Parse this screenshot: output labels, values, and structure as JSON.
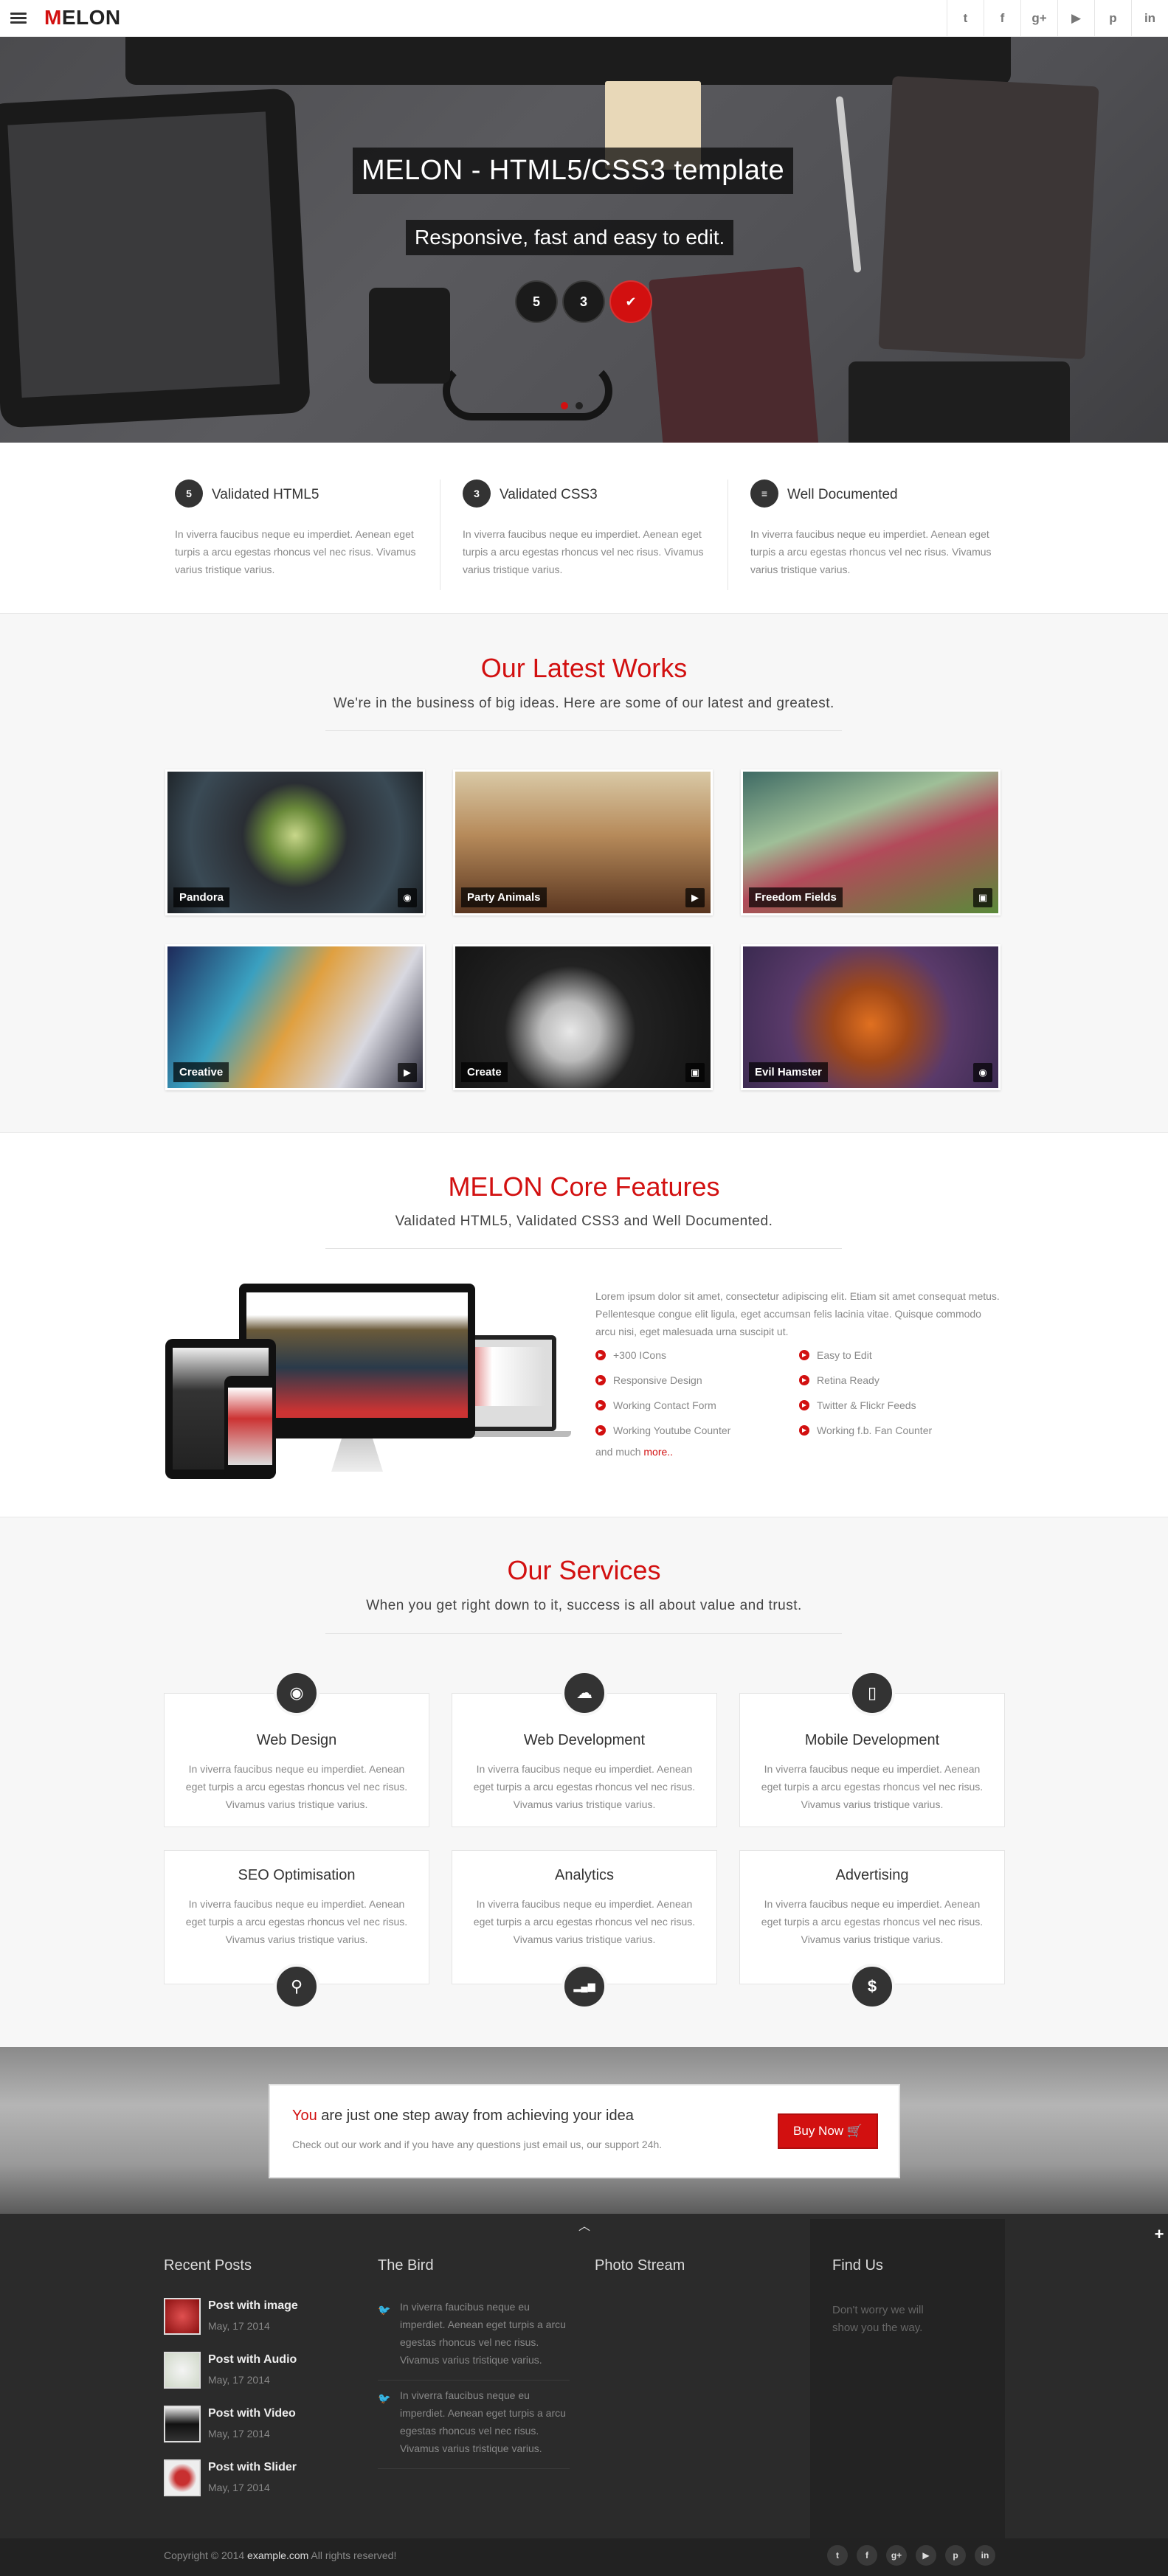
{
  "header": {
    "logo_first": "M",
    "logo_rest": "ELON",
    "social": [
      "twitter-icon",
      "facebook-icon",
      "google-plus-icon",
      "youtube-icon",
      "pinterest-icon",
      "linkedin-icon"
    ],
    "social_glyphs": [
      "t",
      "f",
      "g+",
      "▶",
      "p",
      "in"
    ]
  },
  "hero": {
    "title": "MELON - HTML5/CSS3 template",
    "subtitle": "Responsive, fast and easy to edit.",
    "badges": [
      "5",
      "3",
      "✔"
    ]
  },
  "features": [
    {
      "title": "Validated HTML5",
      "text": "In viverra faucibus neque eu imperdiet. Aenean eget turpis a arcu egestas rhoncus vel nec risus. Vivamus varius tristique varius.",
      "icon": "html5-icon",
      "glyph": "5"
    },
    {
      "title": "Validated CSS3",
      "text": "In viverra faucibus neque eu imperdiet. Aenean eget turpis a arcu egestas rhoncus vel nec risus. Vivamus varius tristique varius.",
      "icon": "css3-icon",
      "glyph": "3"
    },
    {
      "title": "Well Documented",
      "text": "In viverra faucibus neque eu imperdiet. Aenean eget turpis a arcu egestas rhoncus vel nec risus. Vivamus varius tristique varius.",
      "icon": "book-icon",
      "glyph": "≡"
    }
  ],
  "works": {
    "title": "Our Latest Works",
    "subtitle": "We're in the business of big ideas. Here are some of our latest and greatest.",
    "items": [
      {
        "caption": "Pandora",
        "icon": "globe-icon",
        "glyph": "◉"
      },
      {
        "caption": "Party Animals",
        "icon": "play-icon",
        "glyph": "▶"
      },
      {
        "caption": "Freedom Fields",
        "icon": "image-icon",
        "glyph": "▣"
      },
      {
        "caption": "Creative",
        "icon": "play-icon",
        "glyph": "▶"
      },
      {
        "caption": "Create",
        "icon": "image-icon",
        "glyph": "▣"
      },
      {
        "caption": "Evil Hamster",
        "icon": "globe-icon",
        "glyph": "◉"
      }
    ]
  },
  "core": {
    "title": "MELON Core Features",
    "subtitle": "Validated HTML5, Validated CSS3 and Well Documented.",
    "text": "Lorem ipsum dolor sit amet, consectetur adipiscing elit. Etiam sit amet consequat metus. Pellentesque congue elit ligula, eget accumsan felis lacinia vitae. Quisque commodo arcu nisi, eget malesuada urna suscipit ut.",
    "list_left": [
      "+300 ICons",
      "Responsive Design",
      "Working Contact Form",
      "Working Youtube Counter"
    ],
    "list_right": [
      "Easy to Edit",
      "Retina Ready",
      "Twitter & Flickr Feeds",
      "Working f.b. Fan Counter"
    ],
    "more_prefix": "and much ",
    "more_link": "more.."
  },
  "services": {
    "title": "Our Services",
    "subtitle": "When you get right down to it, success is all about value and trust.",
    "items": [
      {
        "title": "Web Design",
        "text": "In viverra faucibus neque eu imperdiet. Aenean eget turpis a arcu egestas rhoncus vel nec risus. Vivamus varius tristique varius.",
        "icon": "globe-icon",
        "glyph": "◉"
      },
      {
        "title": "Web Development",
        "text": "In viverra faucibus neque eu imperdiet. Aenean eget turpis a arcu egestas rhoncus vel nec risus. Vivamus varius tristique varius.",
        "icon": "cloud-icon",
        "glyph": "☁"
      },
      {
        "title": "Mobile Development",
        "text": "In viverra faucibus neque eu imperdiet. Aenean eget turpis a arcu egestas rhoncus vel nec risus. Vivamus varius tristique varius.",
        "icon": "mobile-icon",
        "glyph": "▯"
      },
      {
        "title": "SEO Optimisation",
        "text": "In viverra faucibus neque eu imperdiet. Aenean eget turpis a arcu egestas rhoncus vel nec risus. Vivamus varius tristique varius.",
        "icon": "search-icon",
        "glyph": "⚲"
      },
      {
        "title": "Analytics",
        "text": "In viverra faucibus neque eu imperdiet. Aenean eget turpis a arcu egestas rhoncus vel nec risus. Vivamus varius tristique varius.",
        "icon": "signal-icon",
        "glyph": "▂▄▆"
      },
      {
        "title": "Advertising",
        "text": "In viverra faucibus neque eu imperdiet. Aenean eget turpis a arcu egestas rhoncus vel nec risus. Vivamus varius tristique varius.",
        "icon": "dollar-icon",
        "glyph": "$"
      }
    ]
  },
  "cta": {
    "head_red": "You",
    "head_rest": " are just one step away from achieving your idea",
    "note": "Check out our work and if you have any questions just email us, our support 24h.",
    "button": "Buy Now 🛒"
  },
  "footer": {
    "recent_title": "Recent Posts",
    "bird_title": "The Bird",
    "photo_title": "Photo Stream",
    "find_title": "Find Us",
    "find_note": "Don't worry we will show you the way.",
    "posts": [
      {
        "title": "Post with image",
        "date": "May, 17 2014"
      },
      {
        "title": "Post with Audio",
        "date": "May, 17 2014"
      },
      {
        "title": "Post with Video",
        "date": "May, 17 2014"
      },
      {
        "title": "Post with Slider",
        "date": "May, 17 2014"
      }
    ],
    "tweets": [
      "In viverra faucibus neque eu imperdiet. Aenean eget turpis a arcu egestas rhoncus vel nec risus. Vivamus varius tristique varius.",
      "In viverra faucibus neque eu imperdiet. Aenean eget turpis a arcu egestas rhoncus vel nec risus. Vivamus varius tristique varius."
    ],
    "copyright_prefix": "Copyright © 2014 ",
    "copyright_site": "example.com",
    "copyright_suffix": " All rights reserved!",
    "social_glyphs": [
      "t",
      "f",
      "g+",
      "▶",
      "p",
      "in"
    ]
  },
  "colors": {
    "accent": "#d21010",
    "dark": "#2b2b2b",
    "light": "#f7f7f7"
  }
}
